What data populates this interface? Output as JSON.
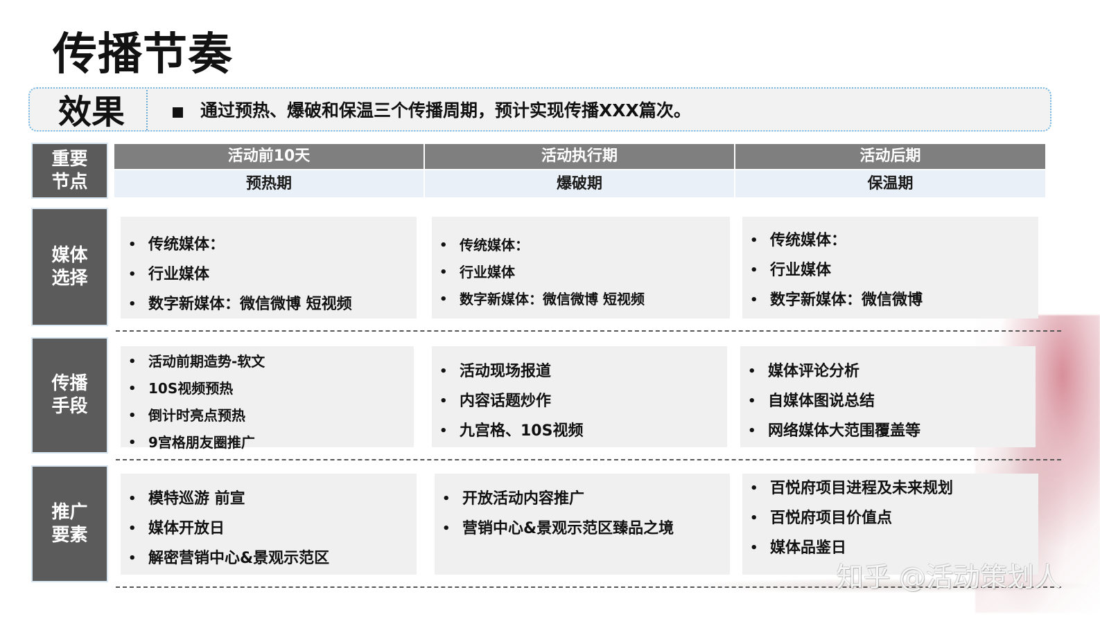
{
  "page": {
    "title": "传播节奏",
    "watermark": "知乎 @活动策划人"
  },
  "effect": {
    "label": "效果",
    "bullet": "■",
    "text": "通过预热、爆破和保温三个传播周期，预计实现传播XXX篇次。"
  },
  "row_labels": {
    "key_nodes": "重要节点",
    "media_selection": "媒体选择",
    "communication_means": "传播手段",
    "promotion_elements": "推广要素"
  },
  "phases": [
    {
      "header": "活动前10天",
      "subheader": "预热期"
    },
    {
      "header": "活动执行期",
      "subheader": "爆破期"
    },
    {
      "header": "活动后期",
      "subheader": "保温期"
    }
  ],
  "rows": {
    "media_selection": [
      [
        "传统媒体：",
        "行业媒体",
        "数字新媒体：微信微博 短视频"
      ],
      [
        "传统媒体：",
        "行业媒体",
        "数字新媒体：微信微博 短视频"
      ],
      [
        "传统媒体：",
        "行业媒体",
        "数字新媒体：微信微博"
      ]
    ],
    "communication_means": [
      [
        "活动前期造势-软文",
        "10S视频预热",
        "倒计时亮点预热",
        "9宫格朋友圈推广"
      ],
      [
        "活动现场报道",
        "内容话题炒作",
        "九宫格、10S视频"
      ],
      [
        "媒体评论分析",
        "自媒体图说总结",
        "网络媒体大范围覆盖等"
      ]
    ],
    "promotion_elements": [
      [
        "模特巡游 前宣",
        "媒体开放日",
        "解密营销中心&景观示范区"
      ],
      [
        "开放活动内容推广",
        "营销中心&景观示范区臻品之境"
      ],
      [
        "百悦府项目进程及未来规划",
        "百悦府项目价值点",
        "媒体品鉴日"
      ]
    ]
  }
}
